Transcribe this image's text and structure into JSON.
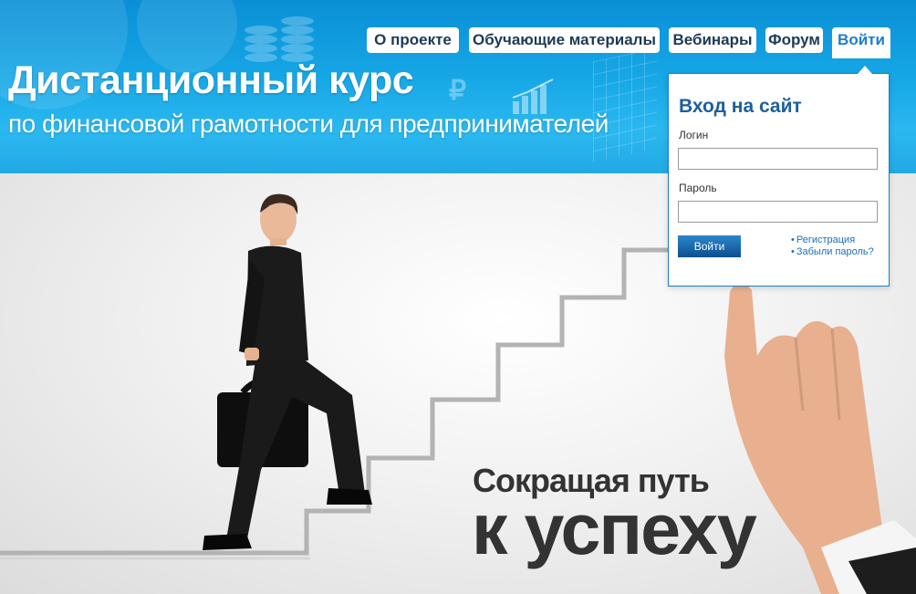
{
  "header": {
    "title": "Дистанционный курс",
    "subtitle": "по финансовой грамотности для предпринимателей",
    "decor_symbol": "₽"
  },
  "nav": {
    "items": [
      {
        "label": "О проекте",
        "name": "nav-about"
      },
      {
        "label": "Обучающие материалы",
        "name": "nav-materials"
      },
      {
        "label": "Вебинары",
        "name": "nav-webinars"
      },
      {
        "label": "Форум",
        "name": "nav-forum"
      },
      {
        "label": "Войти",
        "name": "nav-login",
        "active": true
      }
    ]
  },
  "login": {
    "title": "Вход на сайт",
    "login_label": "Логин",
    "login_value": "",
    "password_label": "Пароль",
    "password_value": "",
    "submit_label": "Войти",
    "register_link": "Регистрация",
    "forgot_link": "Забыли пароль?",
    "bullet": "•"
  },
  "hero": {
    "slogan_line1": "Сокращая путь",
    "slogan_line2": "к успеху"
  },
  "colors": {
    "header_blue": "#16a7e6",
    "accent": "#1a7fcc",
    "slogan": "#333333"
  }
}
